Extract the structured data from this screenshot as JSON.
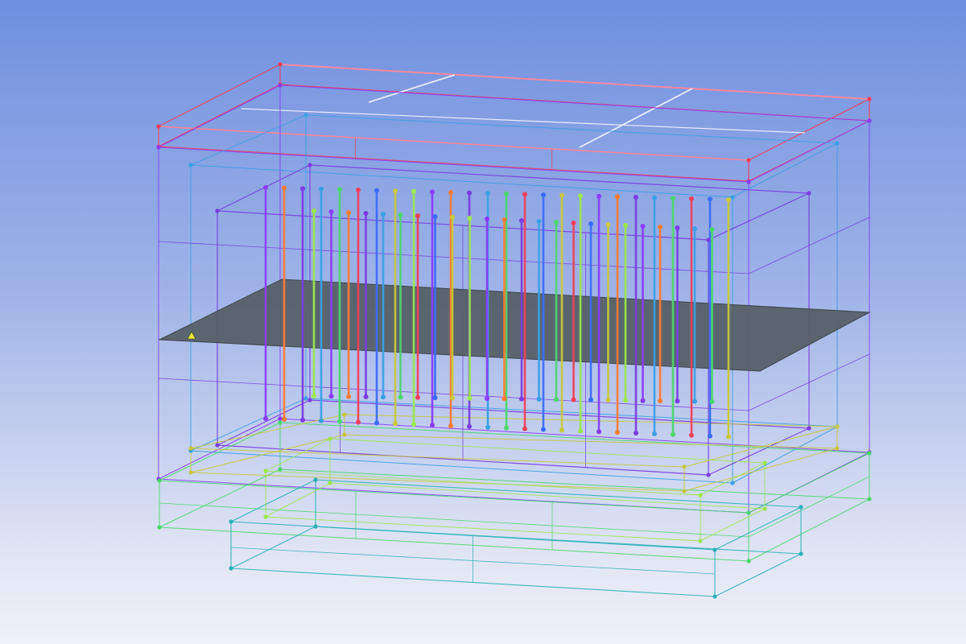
{
  "viewport": {
    "background_top": "#6f8fdf",
    "background_bottom": "#f0f1f8"
  },
  "colors": {
    "red": "#f0405a",
    "pink": "#ff8aa0",
    "violet": "#8a3cff",
    "purple": "#7a3ce0",
    "blue": "#3b6cff",
    "skyblue": "#3aa0e6",
    "green": "#4ad86a",
    "lime": "#9be84a",
    "yellow": "#c8c83a",
    "orange": "#ff7a30",
    "teal": "#2cb0b8",
    "white": "#f4f4ff",
    "plane_fill": "#566068"
  },
  "icons": {
    "origin_marker": "triad-origin-icon"
  }
}
